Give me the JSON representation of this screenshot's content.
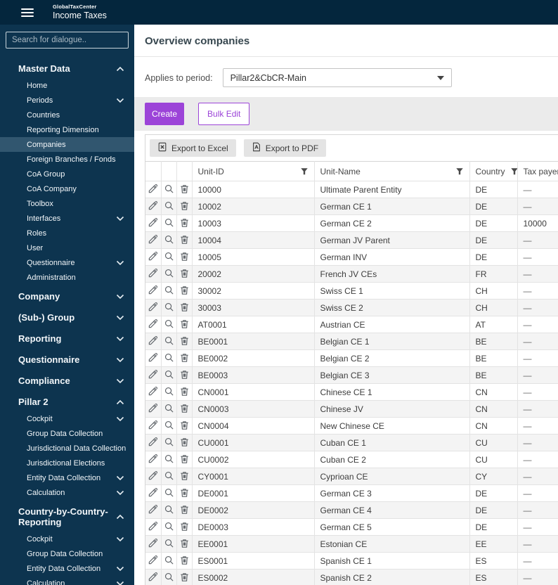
{
  "colors": {
    "topbar_bg": "#04263d",
    "sidebar_bg": "#0d344f",
    "sidebar_selected_bg": "#31566f",
    "accent_purple": "#9c44d8",
    "action_band_bg": "#ebebeb"
  },
  "topbar": {
    "brand_small": "GlobalTaxCenter",
    "brand_large": "Income Taxes"
  },
  "sidebar": {
    "search_placeholder": "Search for dialogue..",
    "items": [
      {
        "label": "Master Data",
        "level": 0,
        "chevron": "up"
      },
      {
        "label": "Home",
        "level": 1
      },
      {
        "label": "Periods",
        "level": 1,
        "chevron": "down"
      },
      {
        "label": "Countries",
        "level": 1
      },
      {
        "label": "Reporting Dimension",
        "level": 1
      },
      {
        "label": "Companies",
        "level": 1,
        "selected": true
      },
      {
        "label": "Foreign Branches / Fonds",
        "level": 1
      },
      {
        "label": "CoA Group",
        "level": 1
      },
      {
        "label": "CoA Company",
        "level": 1
      },
      {
        "label": "Toolbox",
        "level": 1
      },
      {
        "label": "Interfaces",
        "level": 1,
        "chevron": "down"
      },
      {
        "label": "Roles",
        "level": 1
      },
      {
        "label": "User",
        "level": 1
      },
      {
        "label": "Questionnaire",
        "level": 1,
        "chevron": "down"
      },
      {
        "label": "Administration",
        "level": 1
      },
      {
        "label": "Company",
        "level": 0,
        "chevron": "down"
      },
      {
        "label": "(Sub-) Group",
        "level": 0,
        "chevron": "down"
      },
      {
        "label": "Reporting",
        "level": 0,
        "chevron": "down"
      },
      {
        "label": "Questionnaire",
        "level": 0,
        "chevron": "down"
      },
      {
        "label": "Compliance",
        "level": 0,
        "chevron": "down"
      },
      {
        "label": "Pillar 2",
        "level": 0,
        "chevron": "up"
      },
      {
        "label": "Cockpit",
        "level": 1,
        "chevron": "down"
      },
      {
        "label": "Group Data Collection",
        "level": 1
      },
      {
        "label": "Jurisdictional Data Collection",
        "level": 1
      },
      {
        "label": "Jurisdictional Elections",
        "level": 1
      },
      {
        "label": "Entity Data Collection",
        "level": 1,
        "chevron": "down"
      },
      {
        "label": "Calculation",
        "level": 1,
        "chevron": "down"
      },
      {
        "label": "Country-by-Country-Reporting",
        "level": 0,
        "chevron": "up"
      },
      {
        "label": "Cockpit",
        "level": 1,
        "chevron": "down"
      },
      {
        "label": "Group Data Collection",
        "level": 1
      },
      {
        "label": "Entity Data Collection",
        "level": 1,
        "chevron": "down"
      },
      {
        "label": "Calculation",
        "level": 1,
        "chevron": "down"
      }
    ]
  },
  "main": {
    "title": "Overview companies",
    "period": {
      "label": "Applies to period:",
      "value": "Pillar2&CbCR-Main"
    },
    "actions": {
      "create": "Create",
      "bulk_edit": "Bulk Edit"
    },
    "table": {
      "export_excel": "Export to Excel",
      "export_pdf": "Export to PDF",
      "row_actions": [
        "edit",
        "view",
        "delete"
      ],
      "columns": [
        {
          "label": "Unit-ID",
          "filter": "end"
        },
        {
          "label": "Unit-Name",
          "filter": "end"
        },
        {
          "label": "Country",
          "filter": "inline"
        },
        {
          "label": "Tax payer (",
          "filter": "none"
        }
      ],
      "rows": [
        {
          "unit_id": "10000",
          "unit_name": "Ultimate Parent Entity",
          "country": "DE",
          "tax_payer": "—"
        },
        {
          "unit_id": "10002",
          "unit_name": "German CE 1",
          "country": "DE",
          "tax_payer": "—"
        },
        {
          "unit_id": "10003",
          "unit_name": "German CE 2",
          "country": "DE",
          "tax_payer": "10000"
        },
        {
          "unit_id": "10004",
          "unit_name": "German JV Parent",
          "country": "DE",
          "tax_payer": "—"
        },
        {
          "unit_id": "10005",
          "unit_name": "German INV",
          "country": "DE",
          "tax_payer": "—"
        },
        {
          "unit_id": "20002",
          "unit_name": "French JV CEs",
          "country": "FR",
          "tax_payer": "—"
        },
        {
          "unit_id": "30002",
          "unit_name": "Swiss CE 1",
          "country": "CH",
          "tax_payer": "—"
        },
        {
          "unit_id": "30003",
          "unit_name": "Swiss CE 2",
          "country": "CH",
          "tax_payer": "—"
        },
        {
          "unit_id": "AT0001",
          "unit_name": "Austrian CE",
          "country": "AT",
          "tax_payer": "—"
        },
        {
          "unit_id": "BE0001",
          "unit_name": "Belgian CE 1",
          "country": "BE",
          "tax_payer": "—"
        },
        {
          "unit_id": "BE0002",
          "unit_name": "Belgian CE 2",
          "country": "BE",
          "tax_payer": "—"
        },
        {
          "unit_id": "BE0003",
          "unit_name": "Belgian CE 3",
          "country": "BE",
          "tax_payer": "—"
        },
        {
          "unit_id": "CN0001",
          "unit_name": "Chinese CE 1",
          "country": "CN",
          "tax_payer": "—"
        },
        {
          "unit_id": "CN0003",
          "unit_name": "Chinese JV",
          "country": "CN",
          "tax_payer": "—"
        },
        {
          "unit_id": "CN0004",
          "unit_name": "New Chinese CE",
          "country": "CN",
          "tax_payer": "—"
        },
        {
          "unit_id": "CU0001",
          "unit_name": "Cuban CE 1",
          "country": "CU",
          "tax_payer": "—"
        },
        {
          "unit_id": "CU0002",
          "unit_name": "Cuban CE 2",
          "country": "CU",
          "tax_payer": "—"
        },
        {
          "unit_id": "CY0001",
          "unit_name": "Cyprioan CE",
          "country": "CY",
          "tax_payer": "—"
        },
        {
          "unit_id": "DE0001",
          "unit_name": "German CE 3",
          "country": "DE",
          "tax_payer": "—"
        },
        {
          "unit_id": "DE0002",
          "unit_name": "German CE 4",
          "country": "DE",
          "tax_payer": "—"
        },
        {
          "unit_id": "DE0003",
          "unit_name": "German CE 5",
          "country": "DE",
          "tax_payer": "—"
        },
        {
          "unit_id": "EE0001",
          "unit_name": "Estonian CE",
          "country": "EE",
          "tax_payer": "—"
        },
        {
          "unit_id": "ES0001",
          "unit_name": "Spanish CE 1",
          "country": "ES",
          "tax_payer": "—"
        },
        {
          "unit_id": "ES0002",
          "unit_name": "Spanish CE 2",
          "country": "ES",
          "tax_payer": "—"
        }
      ]
    }
  }
}
